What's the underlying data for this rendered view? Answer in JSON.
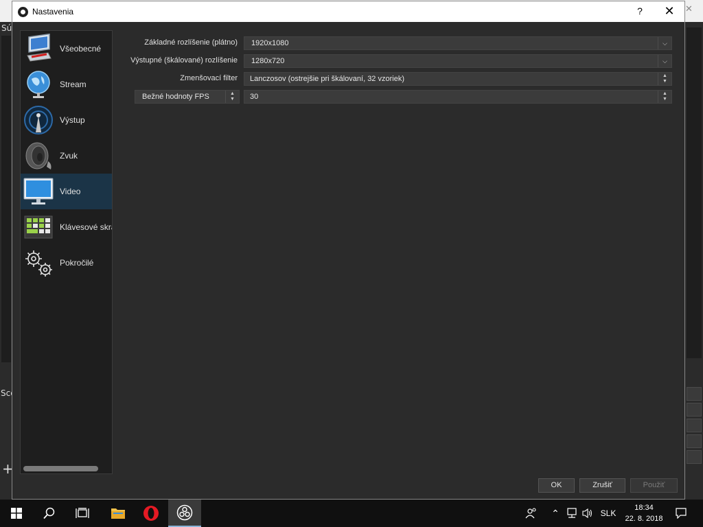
{
  "background_window": {
    "menu_label": "Súb",
    "scenes_label": "Sce"
  },
  "dialog": {
    "title": "Nastavenia",
    "help_label": "?",
    "close_label": "✕"
  },
  "sidebar": {
    "items": [
      {
        "label": "Všeobecné",
        "icon": "general-monitor-icon"
      },
      {
        "label": "Stream",
        "icon": "globe-icon"
      },
      {
        "label": "Výstup",
        "icon": "broadcast-antenna-icon"
      },
      {
        "label": "Zvuk",
        "icon": "speaker-icon"
      },
      {
        "label": "Video",
        "icon": "monitor-icon",
        "active": true
      },
      {
        "label": "Klávesové skra",
        "icon": "keyboard-icon"
      },
      {
        "label": "Pokročilé",
        "icon": "gears-icon"
      }
    ]
  },
  "video_settings": {
    "base_resolution": {
      "label": "Základné rozlíšenie (plátno)",
      "value": "1920x1080"
    },
    "output_resolution": {
      "label": "Výstupné (škálované) rozlíšenie",
      "value": "1280x720"
    },
    "downscale_filter": {
      "label": "Zmenšovací filter",
      "value": "Lanczosov (ostrejšie pri škálovaní, 32 vzoriek)"
    },
    "fps": {
      "mode": "Bežné hodnoty FPS",
      "value": "30"
    }
  },
  "buttons": {
    "ok": "OK",
    "cancel": "Zrušiť",
    "apply": "Použiť"
  },
  "taskbar": {
    "language": "SLK",
    "time": "18:34",
    "date": "22. 8. 2018"
  },
  "colors": {
    "dialog_bg": "#2b2b2b",
    "sidebar_bg": "#1e1e1e",
    "sidebar_active": "#1b3447",
    "field_bg": "#3b3b3b",
    "taskbar_bg": "#101010"
  }
}
